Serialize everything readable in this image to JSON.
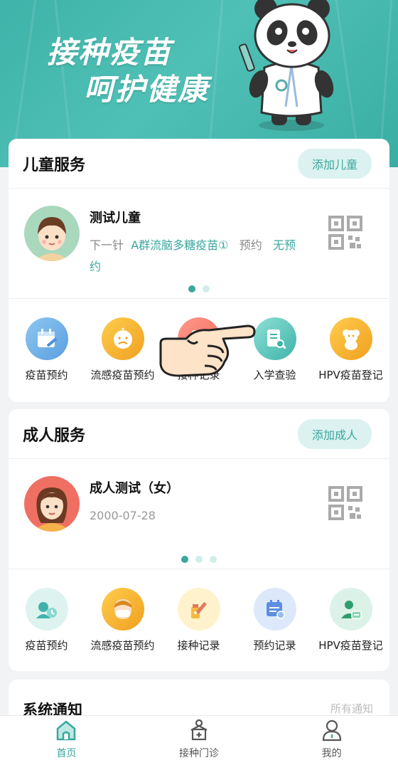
{
  "banner": {
    "line1": "接种疫苗",
    "line2": "呵护健康"
  },
  "child_section": {
    "title": "儿童服务",
    "add_button": "添加儿童",
    "profile": {
      "name": "测试儿童",
      "next_label": "下一针",
      "next_vaccine": "A群流脑多糖疫苗①",
      "appointment_label": "预约",
      "appointment_status": "无预约"
    },
    "services": [
      {
        "label": "疫苗预约",
        "icon": "calendar-syringe-icon"
      },
      {
        "label": "流感疫苗预约",
        "icon": "sick-baby-icon"
      },
      {
        "label": "接种记录",
        "icon": "record-icon"
      },
      {
        "label": "入学查验",
        "icon": "document-search-icon"
      },
      {
        "label": "HPV疫苗登记",
        "icon": "teddy-bear-icon"
      }
    ]
  },
  "adult_section": {
    "title": "成人服务",
    "add_button": "添加成人",
    "profile": {
      "name": "成人测试（女）",
      "birthdate": "2000-07-28"
    },
    "services": [
      {
        "label": "疫苗预约",
        "icon": "user-clock-icon"
      },
      {
        "label": "流感疫苗预约",
        "icon": "masked-face-icon"
      },
      {
        "label": "接种记录",
        "icon": "syringe-bottle-icon"
      },
      {
        "label": "预约记录",
        "icon": "calendar-list-icon"
      },
      {
        "label": "HPV疫苗登记",
        "icon": "user-card-icon"
      }
    ]
  },
  "notice": {
    "title": "系统通知",
    "all_link": "所有通知"
  },
  "tabbar": [
    {
      "label": "首页",
      "icon": "home-icon",
      "active": true
    },
    {
      "label": "接种门诊",
      "icon": "clinic-icon",
      "active": false
    },
    {
      "label": "我的",
      "icon": "user-icon",
      "active": false
    }
  ],
  "colors": {
    "primary": "#3aa79c",
    "banner": "#45b8ad"
  }
}
